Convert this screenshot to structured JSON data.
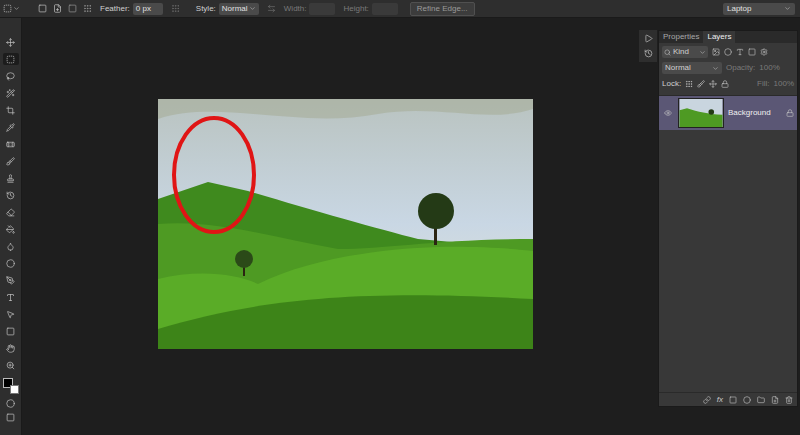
{
  "options_bar": {
    "feather": {
      "label": "Feather:",
      "value": "0 px"
    },
    "style": {
      "label": "Style:",
      "value": "Normal"
    },
    "width": {
      "label": "Width:",
      "value": "",
      "disabled": true
    },
    "height": {
      "label": "Height:",
      "value": "",
      "disabled": true
    },
    "refine_button": "Refine Edge...",
    "workspace": "Laptop"
  },
  "panel": {
    "tabs": [
      {
        "label": "Properties",
        "selected": false
      },
      {
        "label": "Layers",
        "selected": true
      }
    ],
    "filter": "Kind",
    "blend_mode": "Normal",
    "opacity": {
      "label": "Opacity:",
      "value": "100%",
      "disabled": true
    },
    "lock": {
      "label": "Lock:"
    },
    "fill": {
      "label": "Fill:",
      "value": "100%",
      "disabled": true
    },
    "layers": [
      {
        "name": "Background",
        "visible": true,
        "locked": true,
        "selected": true
      }
    ],
    "bottom_fx": "fx"
  }
}
